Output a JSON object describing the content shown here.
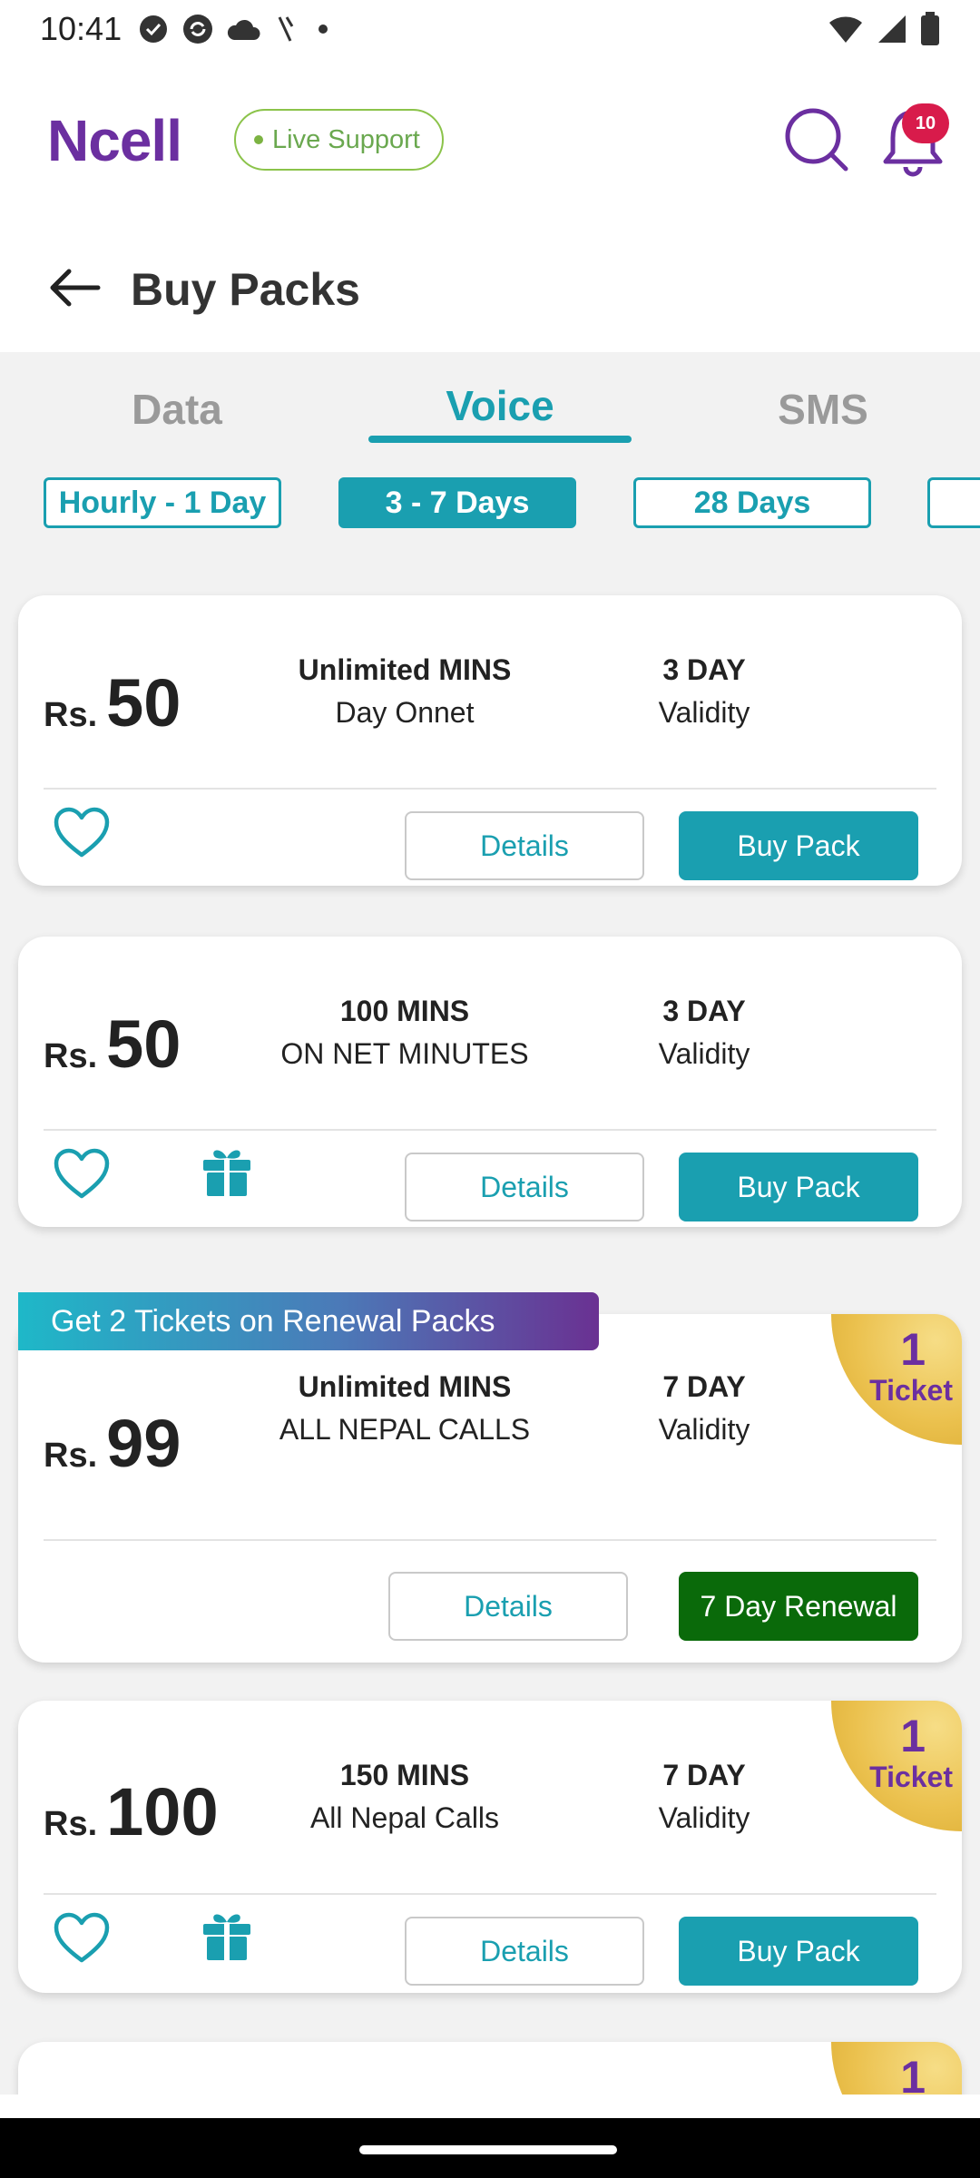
{
  "status_bar": {
    "time": "10:41"
  },
  "header": {
    "logo": "Ncell",
    "live_support": "Live Support",
    "notification_count": "10"
  },
  "page": {
    "title": "Buy Packs"
  },
  "tabs": [
    {
      "label": "Data",
      "active": false
    },
    {
      "label": "Voice",
      "active": true
    },
    {
      "label": "SMS",
      "active": false
    }
  ],
  "filters": [
    {
      "label": "Hourly - 1 Day",
      "active": false
    },
    {
      "label": "3 - 7 Days",
      "active": true
    },
    {
      "label": "28 Days",
      "active": false
    }
  ],
  "promo_banner": "Get 2 Tickets on Renewal Packs",
  "ticket": {
    "count": "1",
    "label": "Ticket"
  },
  "packs": [
    {
      "currency": "Rs.",
      "price": "50",
      "benefit_main": "Unlimited MINS",
      "benefit_sub": "Day Onnet",
      "validity_main": "3 DAY",
      "validity_sub": "Validity",
      "details_label": "Details",
      "action_label": "Buy Pack"
    },
    {
      "currency": "Rs.",
      "price": "50",
      "benefit_main": "100 MINS",
      "benefit_sub": "ON NET MINUTES",
      "validity_main": "3 DAY",
      "validity_sub": "Validity",
      "details_label": "Details",
      "action_label": "Buy Pack"
    },
    {
      "currency": "Rs.",
      "price": "99",
      "benefit_main": "Unlimited MINS",
      "benefit_sub": "ALL NEPAL CALLS",
      "validity_main": "7 DAY",
      "validity_sub": "Validity",
      "details_label": "Details",
      "action_label": "7 Day Renewal"
    },
    {
      "currency": "Rs.",
      "price": "100",
      "benefit_main": "150 MINS",
      "benefit_sub": "All Nepal Calls",
      "validity_main": "7 DAY",
      "validity_sub": "Validity",
      "details_label": "Details",
      "action_label": "Buy Pack"
    }
  ],
  "colors": {
    "brand": "#6b2fa0",
    "accent": "#1a9fb0",
    "renewal": "#0a6a0a",
    "badge": "#d81b4b"
  }
}
